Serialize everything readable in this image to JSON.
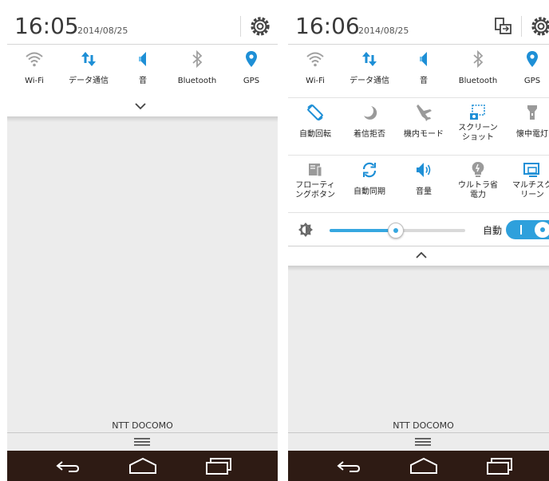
{
  "left": {
    "time": "16:05",
    "date": "2014/08/25",
    "tiles": [
      {
        "label": "Wi-Fi",
        "icon": "wifi-icon"
      },
      {
        "label": "データ通信",
        "icon": "data-transfer-icon"
      },
      {
        "label": "音",
        "icon": "sound-icon"
      },
      {
        "label": "Bluetooth",
        "icon": "bluetooth-icon"
      },
      {
        "label": "GPS",
        "icon": "gps-icon"
      }
    ],
    "carrier": "NTT DOCOMO"
  },
  "right": {
    "time": "16:06",
    "date": "2014/08/25",
    "row1": [
      {
        "label": "Wi-Fi",
        "icon": "wifi-icon"
      },
      {
        "label": "データ通信",
        "icon": "data-transfer-icon"
      },
      {
        "label": "音",
        "icon": "sound-icon"
      },
      {
        "label": "Bluetooth",
        "icon": "bluetooth-icon"
      },
      {
        "label": "GPS",
        "icon": "gps-icon"
      }
    ],
    "row2": [
      {
        "label": "自動回転",
        "icon": "auto-rotate-icon"
      },
      {
        "label": "着信拒否",
        "icon": "moon-icon"
      },
      {
        "label": "機内モード",
        "icon": "airplane-icon"
      },
      {
        "label": "スクリーン",
        "label2": "ショット",
        "icon": "screenshot-icon"
      },
      {
        "label": "懐中電灯",
        "icon": "flashlight-icon"
      }
    ],
    "row3": [
      {
        "label": "フローティ",
        "label2": "ングボタン",
        "icon": "floating-button-icon"
      },
      {
        "label": "自動同期",
        "icon": "sync-icon"
      },
      {
        "label": "音量",
        "icon": "volume-icon"
      },
      {
        "label": "ウルトラ省",
        "label2": "電力",
        "icon": "power-saving-icon"
      },
      {
        "label": "マルチスク",
        "label2": "リーン",
        "icon": "multi-screen-icon"
      }
    ],
    "brightness": {
      "level": 0.49,
      "auto_label": "自動",
      "auto_on": true
    },
    "carrier": "NTT DOCOMO"
  },
  "colors": {
    "accent": "#36a7e0",
    "icon_blue": "#1e8fd6",
    "icon_gray": "#9a9a9a",
    "navbar": "#2e1b14"
  }
}
